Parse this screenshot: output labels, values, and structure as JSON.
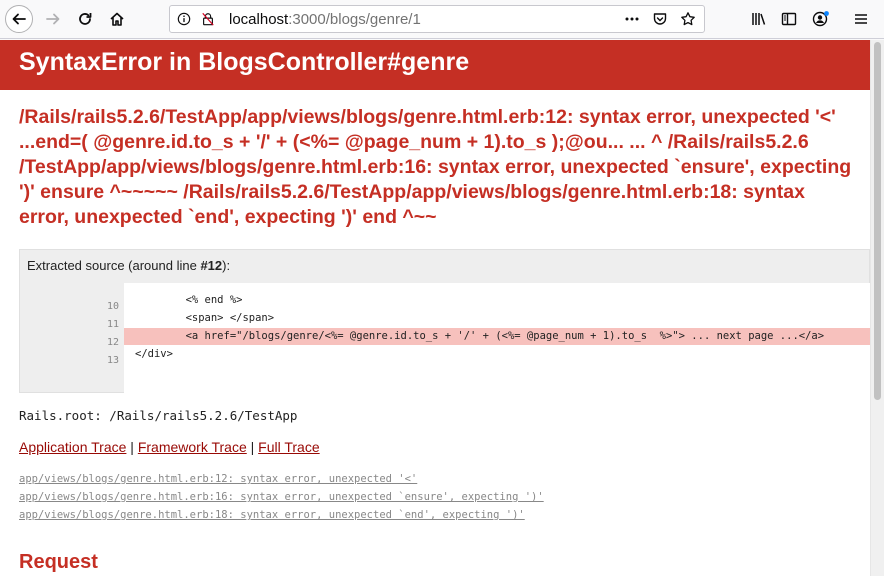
{
  "browser": {
    "url_host": "localhost",
    "url_path": ":3000/blogs/genre/1",
    "icons": [
      "back-icon",
      "forward-icon",
      "reload-icon",
      "home-icon",
      "site-info-icon",
      "lock-icon",
      "page-actions-icon",
      "pocket-icon",
      "bookmark-star-icon",
      "library-icon",
      "sidebar-icon",
      "account-icon",
      "menu-icon"
    ]
  },
  "error": {
    "title": "SyntaxError in BlogsController#genre",
    "message": "/Rails/rails5.2.6/TestApp/app/views/blogs/genre.html.erb:12: syntax error, unexpected '<' ...end=( @genre.id.to_s + '/' + (<%= @page_num + 1).to_s );@ou... ... ^ /Rails/rails5.2.6 /TestApp/app/views/blogs/genre.html.erb:16: syntax error, unexpected `ensure', expecting ')' ensure ^~~~~~ /Rails/rails5.2.6/TestApp/app/views/blogs/genre.html.erb:18: syntax error, unexpected `end', expecting ')' end ^~~"
  },
  "source": {
    "caption_prefix": "Extracted source (around line ",
    "caption_line": "#12",
    "caption_suffix": "):",
    "lines": [
      {
        "num": "10",
        "code": "        <% end %>",
        "highlight": false
      },
      {
        "num": "11",
        "code": "        <span> </span>",
        "highlight": false
      },
      {
        "num": "12",
        "code": "        <a href=\"/blogs/genre/<%= @genre.id.to_s + '/' + (<%= @page_num + 1).to_s  %>\"> ... next page ...</a>",
        "highlight": true
      },
      {
        "num": "13",
        "code": "</div>",
        "highlight": false
      }
    ]
  },
  "rails_root": "Rails.root: /Rails/rails5.2.6/TestApp",
  "trace": {
    "links": [
      "Application Trace",
      "Framework Trace",
      "Full Trace"
    ],
    "separator": "|",
    "lines": [
      "app/views/blogs/genre.html.erb:12: syntax error, unexpected '<'",
      "app/views/blogs/genre.html.erb:16: syntax error, unexpected `ensure', expecting ')'",
      "app/views/blogs/genre.html.erb:18: syntax error, unexpected `end', expecting ')'"
    ]
  },
  "request_heading": "Request",
  "colors": {
    "accent": "#c52f24",
    "link": "#980905",
    "highlight": "#f7c1bd"
  }
}
